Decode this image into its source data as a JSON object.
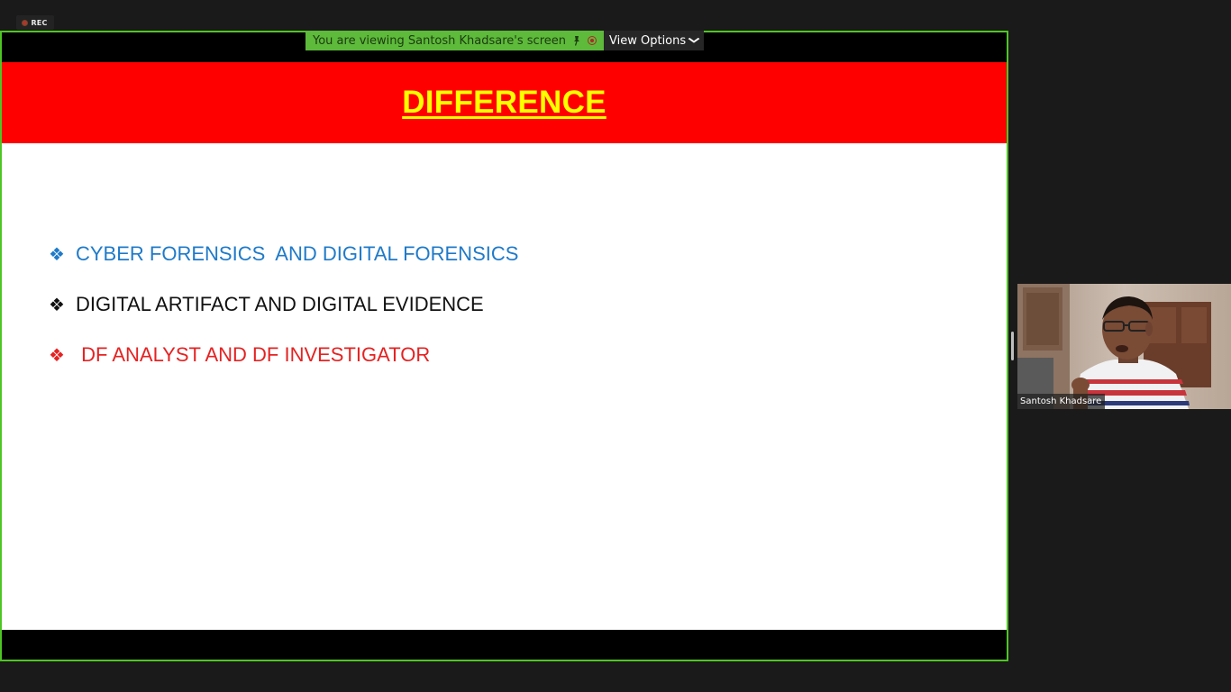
{
  "recording": {
    "label": "REC"
  },
  "share_banner": {
    "viewing_text": "You are viewing Santosh Khadsare's screen",
    "view_options_label": "View Options",
    "icons": [
      "pin-icon",
      "stop-share-icon",
      "chevron-down-icon"
    ]
  },
  "slide": {
    "title": "DIFFERENCE",
    "bullets": [
      {
        "icon": "❖",
        "text": "CYBER FORENSICS  AND DIGITAL FORENSICS",
        "color": "#1f7ac9"
      },
      {
        "icon": "❖",
        "text": "DIGITAL ARTIFACT AND DIGITAL EVIDENCE",
        "color": "#111111"
      },
      {
        "icon": "❖",
        "text": " DF ANALYST AND DF INVESTIGATOR",
        "color": "#e52222"
      }
    ],
    "colors": {
      "header_bg": "#ff0000",
      "title": "#ffff00"
    }
  },
  "participant": {
    "name": "Santosh Khadsare"
  },
  "colors": {
    "share_border": "#4fc525",
    "background": "#1a1a1a"
  }
}
